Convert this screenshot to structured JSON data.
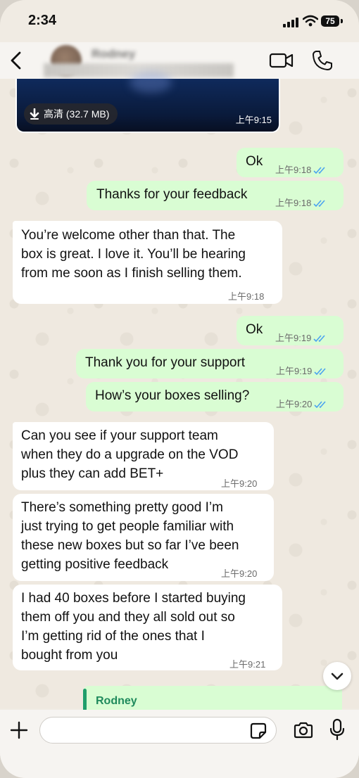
{
  "status_bar": {
    "time": "2:34",
    "battery": "75"
  },
  "header": {
    "contact_name": "Rodney"
  },
  "media_message": {
    "quality_label": "高清 (32.7 MB)",
    "time": "上午9:15"
  },
  "messages": [
    {
      "direction": "out",
      "text": "Ok",
      "time": "上午9:18"
    },
    {
      "direction": "out",
      "text": "Thanks for your feedback",
      "time": "上午9:18"
    },
    {
      "direction": "in",
      "text": "You’re welcome other than that. The\nbox is great. I love it. You’ll be hearing\nfrom me soon as I finish selling them.",
      "time": "上午9:18"
    },
    {
      "direction": "out",
      "text": "Ok",
      "time": "上午9:19"
    },
    {
      "direction": "out",
      "text": "Thank you for your support",
      "time": "上午9:19"
    },
    {
      "direction": "out",
      "text": "How’s your boxes selling?",
      "time": "上午9:20"
    },
    {
      "direction": "in",
      "text": "Can you see if your support team\nwhen they do a upgrade on the VOD\nplus they can add BET+",
      "time": "上午9:20"
    },
    {
      "direction": "in",
      "text": "There’s something pretty good I’m\njust trying to get people familiar with\nthese new boxes but so far I’ve been\ngetting positive feedback",
      "time": "上午9:20"
    },
    {
      "direction": "in",
      "text": "I had 40 boxes before I started buying\nthem off you and they all sold out so\nI’m getting rid of the ones that I\nbought from you",
      "time": "上午9:21"
    }
  ],
  "reply_preview": {
    "name": "Rodney"
  },
  "composer": {
    "value": "",
    "placeholder": ""
  },
  "icons": {
    "back": "chevron-left-icon",
    "video": "video-camera-icon",
    "call": "phone-icon",
    "download": "download-arrow-icon",
    "read_receipt": "double-check-icon",
    "scroll_down": "chevron-down-icon",
    "attach": "plus-icon",
    "sticker": "sticker-icon",
    "camera": "camera-icon",
    "mic": "microphone-icon"
  },
  "colors": {
    "outgoing_bubble": "#d9fdd3",
    "incoming_bubble": "#ffffff",
    "read_tick": "#4aa3f0",
    "reply_accent": "#1f9e6a"
  }
}
